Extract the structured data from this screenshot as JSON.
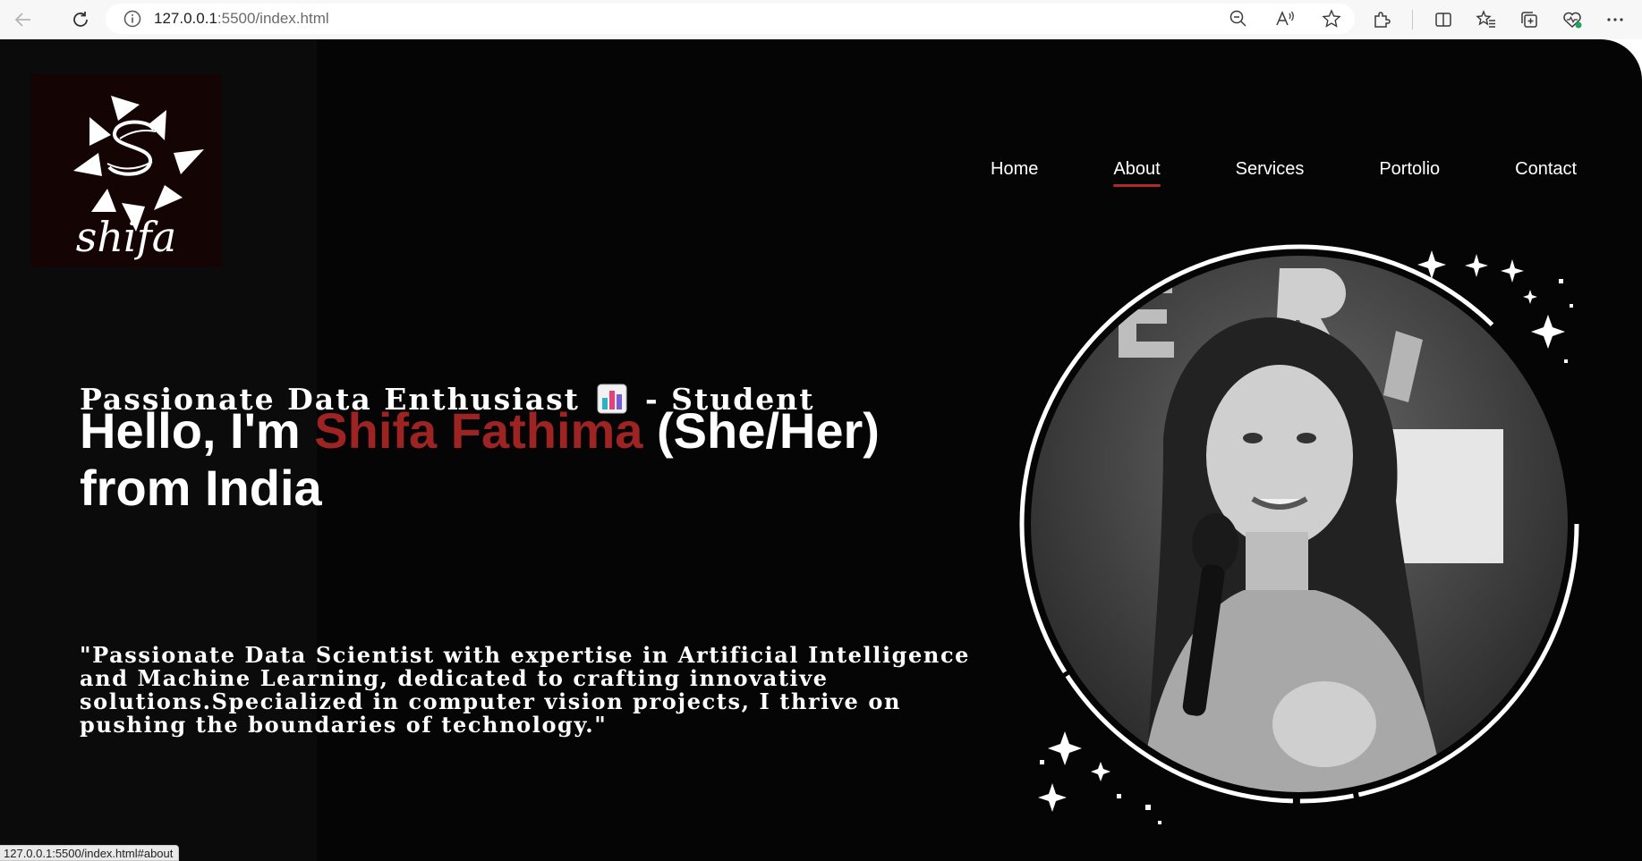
{
  "browser": {
    "url_host": "127.0.0.1",
    "url_rest": ":5500/index.html",
    "status_url": "127.0.0.1:5500/index.html#about"
  },
  "logo": {
    "text": "shifa"
  },
  "nav": {
    "items": [
      {
        "label": "Home"
      },
      {
        "label": "About",
        "active": true
      },
      {
        "label": "Services"
      },
      {
        "label": "Portolio"
      },
      {
        "label": "Contact"
      }
    ]
  },
  "hero": {
    "tagline_before": "Passionate Data Enthusiast",
    "tagline_after": " - Student",
    "greeting": "Hello, I'm ",
    "name": "Shifa Fathima",
    "pronouns": " (She/Her)",
    "origin": "from India",
    "bio": "\"Passionate Data Scientist with expertise in Artificial Intelligence and Machine Learning, dedicated to crafting innovative solutions.Specialized in computer vision projects, I thrive on pushing the boundaries of technology.\""
  },
  "colors": {
    "accent": "#9e2424",
    "underline": "#b02a2a",
    "background": "#050505"
  },
  "icons": [
    "back-icon",
    "refresh-icon",
    "info-icon",
    "zoom-out-icon",
    "read-aloud-icon",
    "favorite-star-icon",
    "extensions-icon",
    "split-screen-icon",
    "favorites-icon",
    "collections-icon",
    "browser-essentials-icon",
    "more-icon"
  ]
}
